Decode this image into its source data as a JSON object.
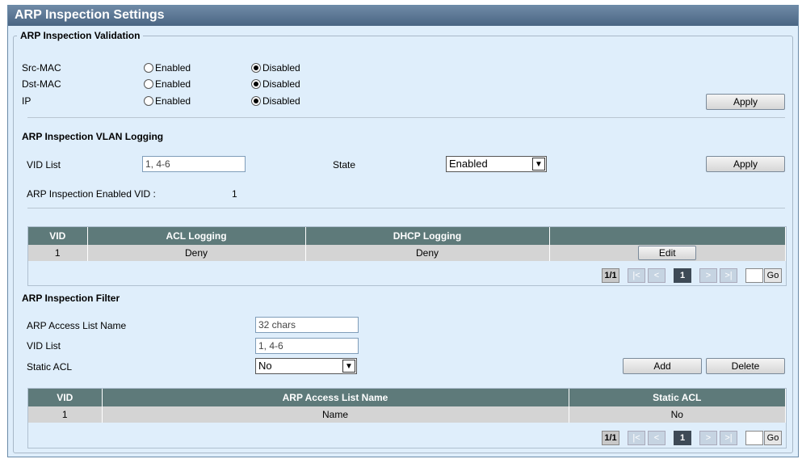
{
  "title": "ARP Inspection Settings",
  "validation": {
    "legend": "ARP Inspection Validation",
    "rows": [
      {
        "label": "Src-MAC",
        "enabled": "Enabled",
        "disabled": "Disabled"
      },
      {
        "label": "Dst-MAC",
        "enabled": "Enabled",
        "disabled": "Disabled"
      },
      {
        "label": "IP",
        "enabled": "Enabled",
        "disabled": "Disabled"
      }
    ],
    "apply": "Apply"
  },
  "vlan_logging": {
    "heading": "ARP Inspection VLAN Logging",
    "vid_label": "VID List",
    "vid_value": "1, 4-6",
    "state_label": "State",
    "state_value": "Enabled",
    "apply": "Apply",
    "enabled_vid_label": "ARP Inspection Enabled VID :",
    "enabled_vid_value": "1",
    "table": {
      "headers": [
        "VID",
        "ACL Logging",
        "DHCP Logging",
        ""
      ],
      "rows": [
        {
          "vid": "1",
          "acl": "Deny",
          "dhcp": "Deny",
          "action": "Edit"
        }
      ]
    },
    "pager": {
      "total": "1/1",
      "first": "|<",
      "prev": "<",
      "current": "1",
      "next": ">",
      "last": ">|",
      "go": "Go"
    }
  },
  "filter": {
    "heading": "ARP Inspection Filter",
    "name_label": "ARP Access List Name",
    "name_placeholder": "32 chars",
    "vid_label": "VID List",
    "vid_placeholder": "1, 4-6",
    "static_label": "Static ACL",
    "static_value": "No",
    "add": "Add",
    "delete": "Delete",
    "table": {
      "headers": [
        "VID",
        "ARP Access List Name",
        "Static ACL"
      ],
      "rows": [
        {
          "vid": "1",
          "name": "Name",
          "static": "No"
        }
      ]
    },
    "pager": {
      "total": "1/1",
      "first": "|<",
      "prev": "<",
      "current": "1",
      "next": ">",
      "last": ">|",
      "go": "Go"
    }
  }
}
